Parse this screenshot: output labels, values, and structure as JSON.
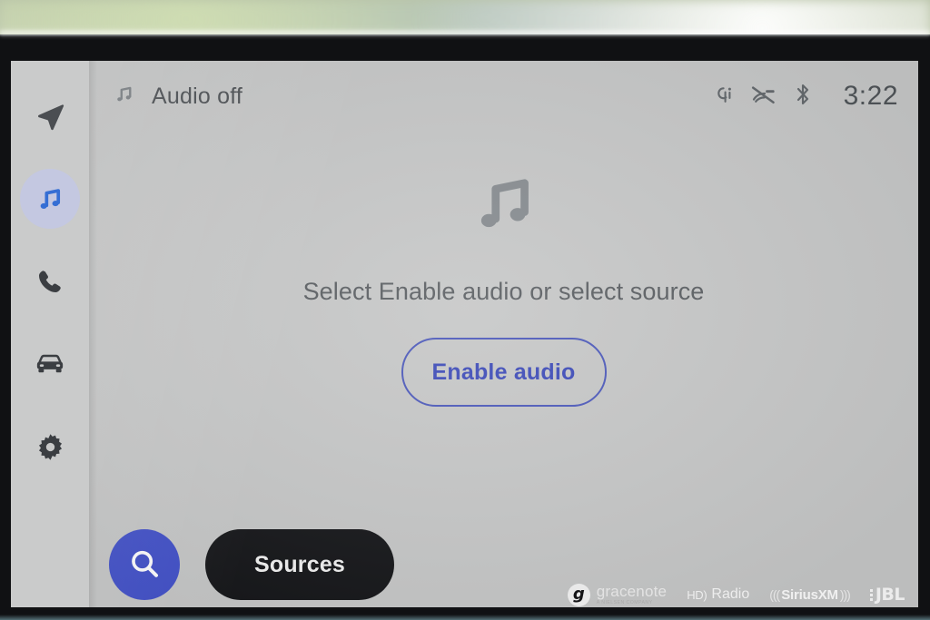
{
  "device": {
    "type": "car-infotainment-touchscreen",
    "clock": "3:22"
  },
  "status_bar": {
    "title": "Audio off",
    "title_icon": "music-note-icon",
    "icons": [
      {
        "name": "wireless-charging-qi-icon",
        "label": "Qi"
      },
      {
        "name": "voice-recognition-muted-icon",
        "label": "Voice off"
      },
      {
        "name": "bluetooth-icon",
        "label": "Bluetooth"
      }
    ],
    "clock": "3:22"
  },
  "sidebar": {
    "items": [
      {
        "name": "sidebar-item-navigation",
        "icon": "navigation-arrow-icon",
        "active": false
      },
      {
        "name": "sidebar-item-media",
        "icon": "music-note-icon",
        "active": true
      },
      {
        "name": "sidebar-item-phone",
        "icon": "phone-handset-icon",
        "active": false
      },
      {
        "name": "sidebar-item-vehicle",
        "icon": "car-front-icon",
        "active": false
      },
      {
        "name": "sidebar-item-settings",
        "icon": "gear-icon",
        "active": false
      }
    ]
  },
  "main": {
    "empty_state_icon": "music-note-icon",
    "message": "Select Enable audio or select source",
    "enable_audio_label": "Enable audio",
    "search_icon": "search-icon",
    "sources_label": "Sources"
  },
  "brands": {
    "gracenote": {
      "name": "gracenote",
      "sub": "A NIELSEN COMPANY",
      "mark": "g"
    },
    "hd_radio": {
      "mark": "HD",
      "mark_suffix": ")",
      "word": "Radio"
    },
    "siriusxm": {
      "left_wave": "(((",
      "word_sirius": "Sirius",
      "word_xm": "XM",
      "right_wave": ")))"
    },
    "jbl": {
      "word": "JBL"
    }
  },
  "colors": {
    "screen_background": "#c8c9c9",
    "accent_blue": "#3f4fd6",
    "button_outline_blue": "#4a59c4",
    "sources_black": "#16171a",
    "active_pill": "#c3c8e4",
    "text_primary": "#4a4e52",
    "bezel": "#101113"
  }
}
